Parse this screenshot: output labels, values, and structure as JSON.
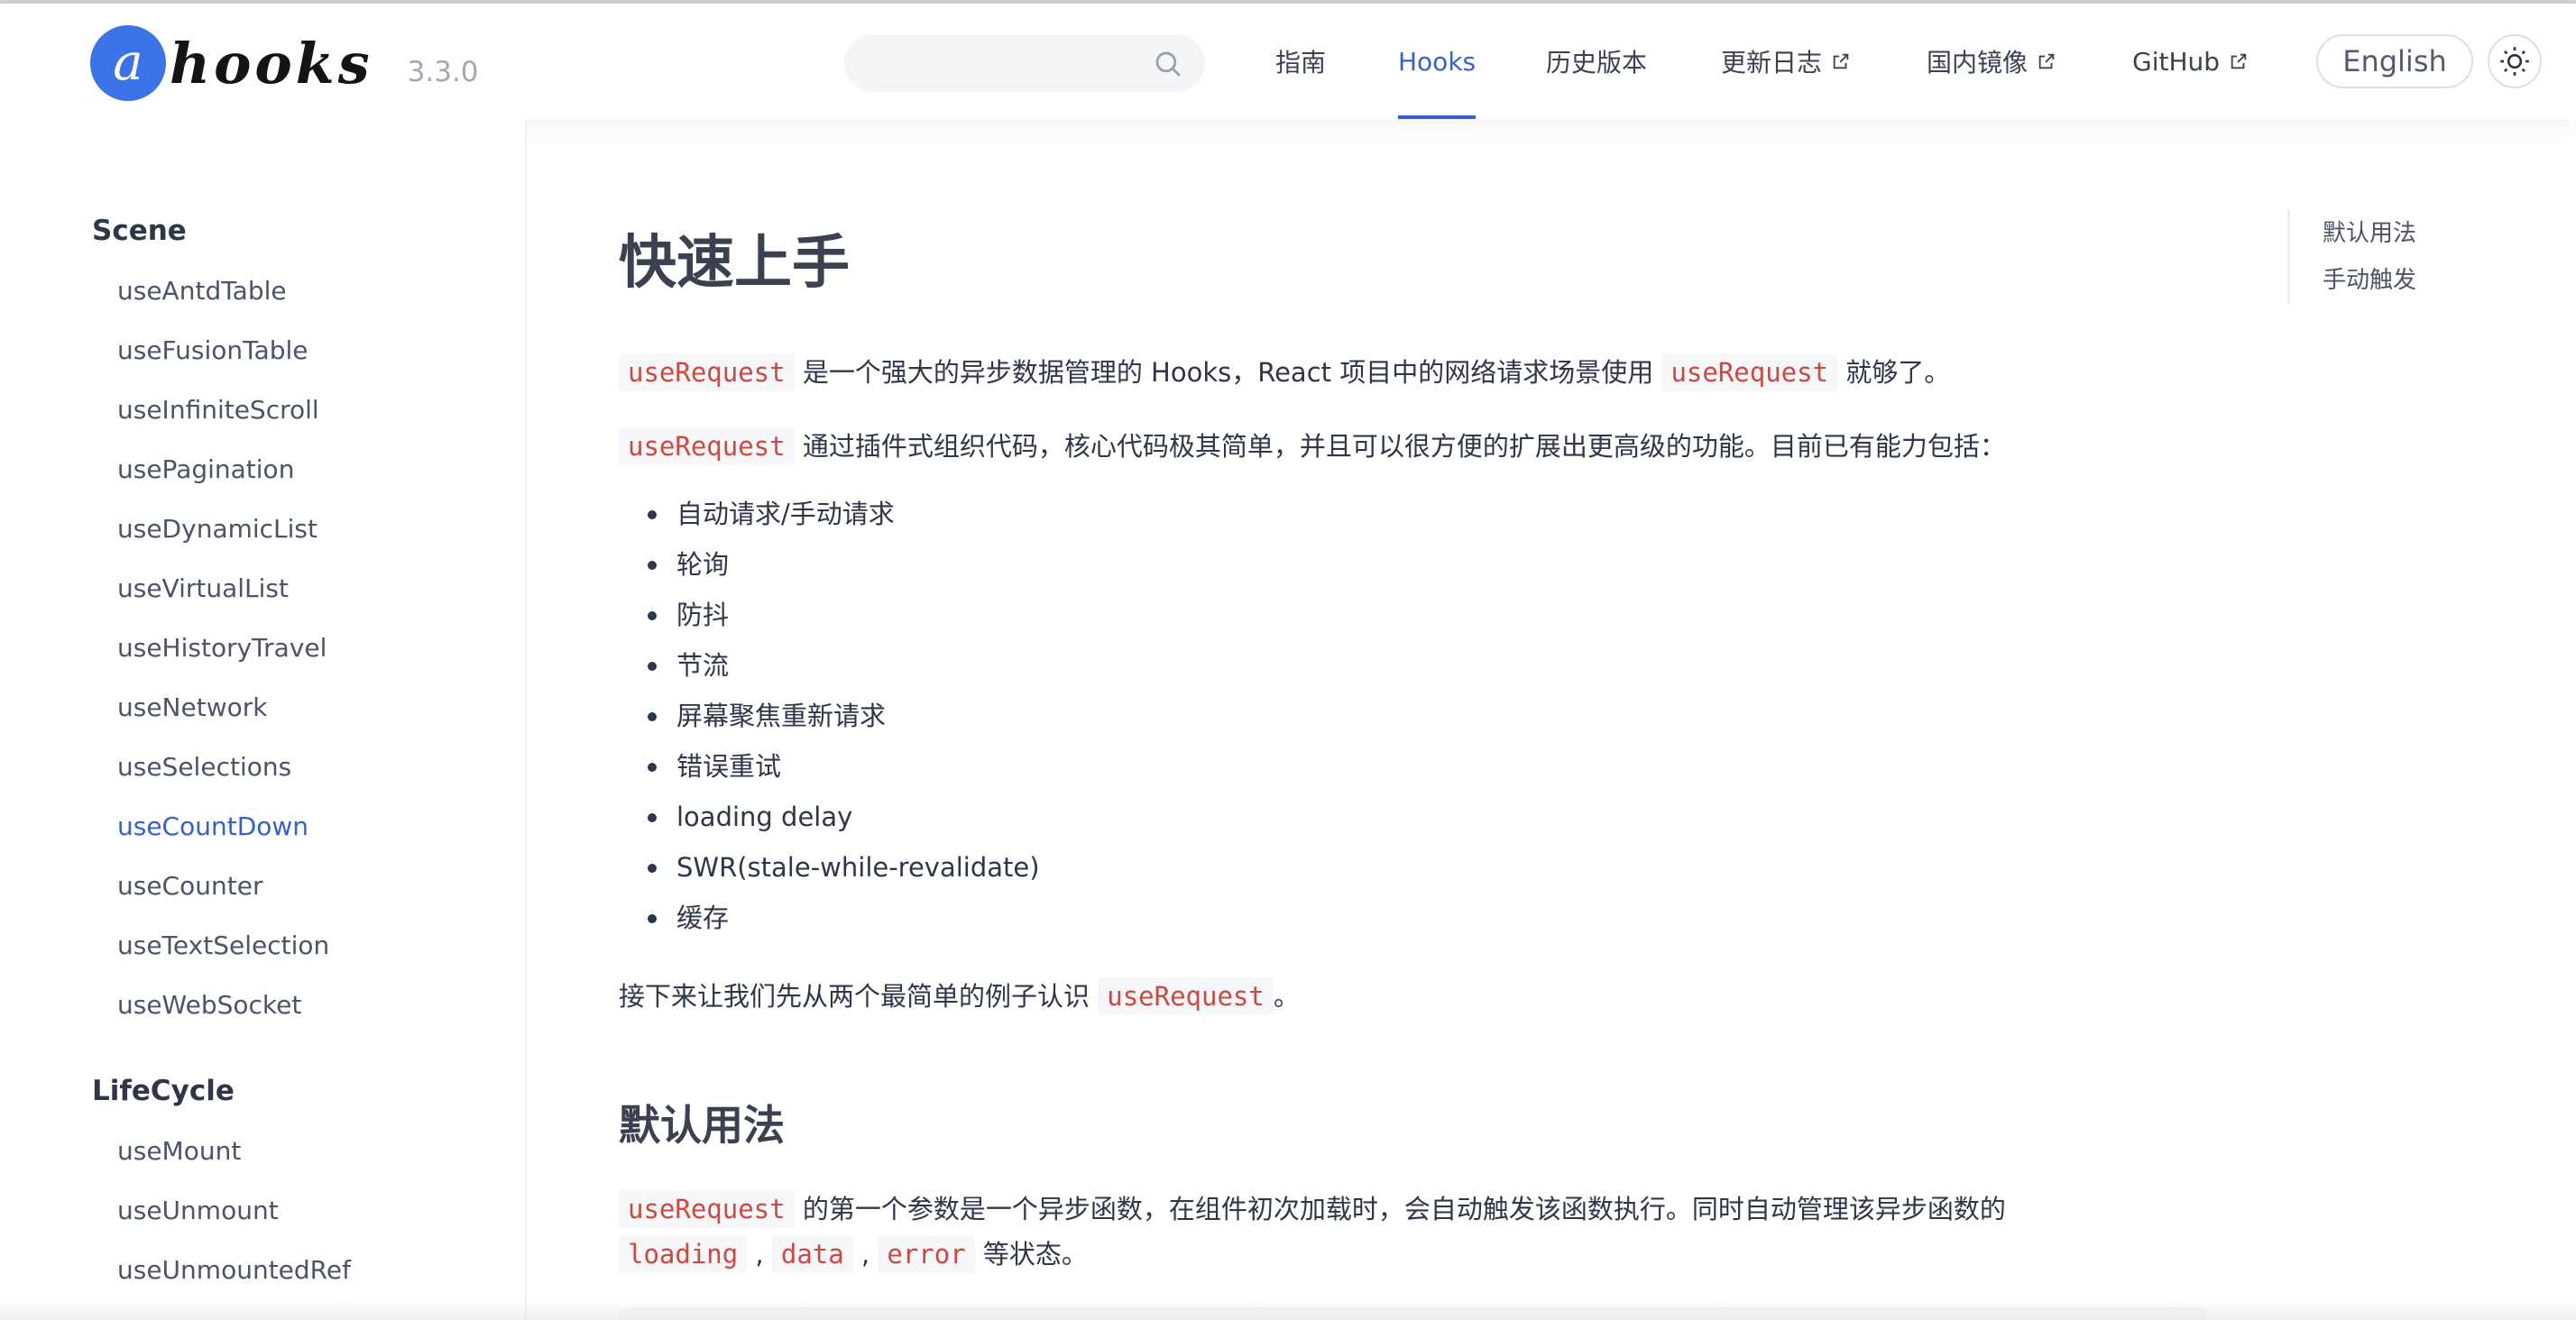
{
  "header": {
    "logo_letter": "a",
    "logo_text": "hooks",
    "version": "3.3.0",
    "search": {
      "placeholder": "",
      "icon": "search-icon"
    },
    "nav": [
      {
        "label": "指南",
        "external": false,
        "active": false
      },
      {
        "label": "Hooks",
        "external": false,
        "active": true
      },
      {
        "label": "历史版本",
        "external": false,
        "active": false
      },
      {
        "label": "更新日志",
        "external": true,
        "active": false
      },
      {
        "label": "国内镜像",
        "external": true,
        "active": false
      },
      {
        "label": "GitHub",
        "external": true,
        "active": false
      }
    ],
    "language_button": "English",
    "theme_icon": "sun-icon"
  },
  "sidebar": {
    "groups": [
      {
        "title": "Scene",
        "items": [
          "useAntdTable",
          "useFusionTable",
          "useInfiniteScroll",
          "usePagination",
          "useDynamicList",
          "useVirtualList",
          "useHistoryTravel",
          "useNetwork",
          "useSelections",
          "useCountDown",
          "useCounter",
          "useTextSelection",
          "useWebSocket"
        ]
      },
      {
        "title": "LifeCycle",
        "items": [
          "useMount",
          "useUnmount",
          "useUnmountedRef"
        ]
      }
    ],
    "active_item": "useCountDown"
  },
  "main": {
    "title": "快速上手",
    "intro1": {
      "code1": "useRequest",
      "text1": " 是一个强大的异步数据管理的 Hooks，React 项目中的网络请求场景使用 ",
      "code2": "useRequest",
      "text2": " 就够了。"
    },
    "intro2": {
      "code1": "useRequest",
      "text1": " 通过插件式组织代码，核心代码极其简单，并且可以很方便的扩展出更高级的功能。目前已有能力包括："
    },
    "features": [
      "自动请求/手动请求",
      "轮询",
      "防抖",
      "节流",
      "屏幕聚焦重新请求",
      "错误重试",
      "loading delay",
      "SWR(stale-while-revalidate)",
      "缓存"
    ],
    "outro": {
      "text1": "接下来让我们先从两个最简单的例子认识 ",
      "code1": "useRequest",
      "text2": "。"
    },
    "section1": {
      "title": "默认用法",
      "line1_code": "useRequest",
      "line1_text": " 的第一个参数是一个异步函数，在组件初次加载时，会自动触发该函数执行。同时自动管理该异步函数的",
      "line2_code1": "loading",
      "line2_sep1": " , ",
      "line2_code2": "data",
      "line2_sep2": " , ",
      "line2_code3": "error",
      "line2_text": " 等状态。"
    }
  },
  "toc": [
    "默认用法",
    "手动触发"
  ],
  "colors": {
    "accent": "#3561d0",
    "logo": "#3b73e8",
    "code": "#d0473f"
  }
}
